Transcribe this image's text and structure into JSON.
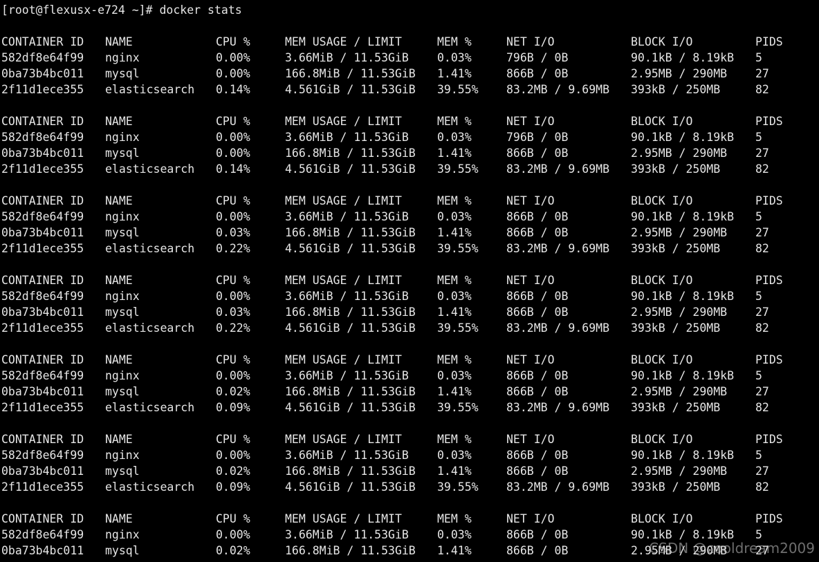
{
  "colors": {
    "background": "#000000",
    "text": "#e6e6e6"
  },
  "prompt": "[root@flexusx-e724 ~]# docker stats",
  "header": [
    "CONTAINER ID",
    "NAME",
    "CPU %",
    "MEM USAGE / LIMIT",
    "MEM %",
    "NET I/O",
    "BLOCK I/O",
    "PIDS"
  ],
  "blocks": [
    {
      "rows": [
        [
          "582df8e64f99",
          "nginx",
          "0.00%",
          "3.66MiB / 11.53GiB",
          "0.03%",
          "796B / 0B",
          "90.1kB / 8.19kB",
          "5"
        ],
        [
          "0ba73b4bc011",
          "mysql",
          "0.00%",
          "166.8MiB / 11.53GiB",
          "1.41%",
          "866B / 0B",
          "2.95MB / 290MB",
          "27"
        ],
        [
          "2f11d1ece355",
          "elasticsearch",
          "0.14%",
          "4.561GiB / 11.53GiB",
          "39.55%",
          "83.2MB / 9.69MB",
          "393kB / 250MB",
          "82"
        ]
      ]
    },
    {
      "rows": [
        [
          "582df8e64f99",
          "nginx",
          "0.00%",
          "3.66MiB / 11.53GiB",
          "0.03%",
          "796B / 0B",
          "90.1kB / 8.19kB",
          "5"
        ],
        [
          "0ba73b4bc011",
          "mysql",
          "0.00%",
          "166.8MiB / 11.53GiB",
          "1.41%",
          "866B / 0B",
          "2.95MB / 290MB",
          "27"
        ],
        [
          "2f11d1ece355",
          "elasticsearch",
          "0.14%",
          "4.561GiB / 11.53GiB",
          "39.55%",
          "83.2MB / 9.69MB",
          "393kB / 250MB",
          "82"
        ]
      ]
    },
    {
      "rows": [
        [
          "582df8e64f99",
          "nginx",
          "0.00%",
          "3.66MiB / 11.53GiB",
          "0.03%",
          "866B / 0B",
          "90.1kB / 8.19kB",
          "5"
        ],
        [
          "0ba73b4bc011",
          "mysql",
          "0.03%",
          "166.8MiB / 11.53GiB",
          "1.41%",
          "866B / 0B",
          "2.95MB / 290MB",
          "27"
        ],
        [
          "2f11d1ece355",
          "elasticsearch",
          "0.22%",
          "4.561GiB / 11.53GiB",
          "39.55%",
          "83.2MB / 9.69MB",
          "393kB / 250MB",
          "82"
        ]
      ]
    },
    {
      "rows": [
        [
          "582df8e64f99",
          "nginx",
          "0.00%",
          "3.66MiB / 11.53GiB",
          "0.03%",
          "866B / 0B",
          "90.1kB / 8.19kB",
          "5"
        ],
        [
          "0ba73b4bc011",
          "mysql",
          "0.03%",
          "166.8MiB / 11.53GiB",
          "1.41%",
          "866B / 0B",
          "2.95MB / 290MB",
          "27"
        ],
        [
          "2f11d1ece355",
          "elasticsearch",
          "0.22%",
          "4.561GiB / 11.53GiB",
          "39.55%",
          "83.2MB / 9.69MB",
          "393kB / 250MB",
          "82"
        ]
      ]
    },
    {
      "rows": [
        [
          "582df8e64f99",
          "nginx",
          "0.00%",
          "3.66MiB / 11.53GiB",
          "0.03%",
          "866B / 0B",
          "90.1kB / 8.19kB",
          "5"
        ],
        [
          "0ba73b4bc011",
          "mysql",
          "0.02%",
          "166.8MiB / 11.53GiB",
          "1.41%",
          "866B / 0B",
          "2.95MB / 290MB",
          "27"
        ],
        [
          "2f11d1ece355",
          "elasticsearch",
          "0.09%",
          "4.561GiB / 11.53GiB",
          "39.55%",
          "83.2MB / 9.69MB",
          "393kB / 250MB",
          "82"
        ]
      ]
    },
    {
      "rows": [
        [
          "582df8e64f99",
          "nginx",
          "0.00%",
          "3.66MiB / 11.53GiB",
          "0.03%",
          "866B / 0B",
          "90.1kB / 8.19kB",
          "5"
        ],
        [
          "0ba73b4bc011",
          "mysql",
          "0.02%",
          "166.8MiB / 11.53GiB",
          "1.41%",
          "866B / 0B",
          "2.95MB / 290MB",
          "27"
        ],
        [
          "2f11d1ece355",
          "elasticsearch",
          "0.09%",
          "4.561GiB / 11.53GiB",
          "39.55%",
          "83.2MB / 9.69MB",
          "393kB / 250MB",
          "82"
        ]
      ]
    },
    {
      "rows": [
        [
          "582df8e64f99",
          "nginx",
          "0.00%",
          "3.66MiB / 11.53GiB",
          "0.03%",
          "866B / 0B",
          "90.1kB / 8.19kB",
          "5"
        ],
        [
          "0ba73b4bc011",
          "mysql",
          "0.02%",
          "166.8MiB / 11.53GiB",
          "1.41%",
          "866B / 0B",
          "2.95MB / 290MB",
          "27"
        ]
      ]
    }
  ],
  "watermark": "CSDN @cooldream2009"
}
